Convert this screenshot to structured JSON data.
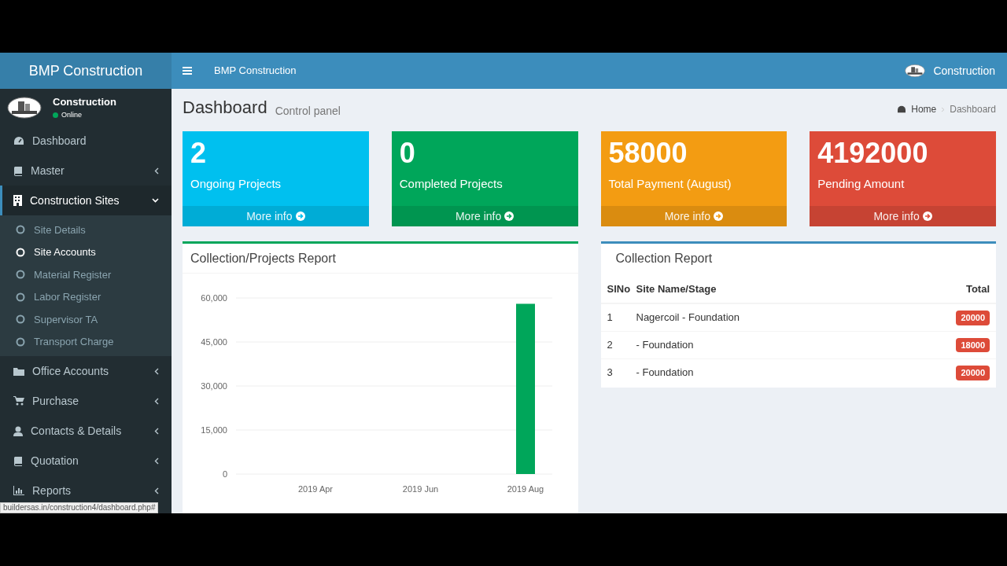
{
  "brand": "BMP Construction",
  "topbar": {
    "title": "BMP Construction",
    "user": "Construction"
  },
  "user_panel": {
    "name": "Construction",
    "status": "Online"
  },
  "menu": [
    {
      "label": "Dashboard",
      "kind": "link"
    },
    {
      "label": "Master",
      "kind": "tree",
      "expanded": false
    },
    {
      "label": "Construction Sites",
      "kind": "tree",
      "expanded": true,
      "children": [
        {
          "label": "Site Details",
          "selected": false
        },
        {
          "label": "Site Accounts",
          "selected": true
        },
        {
          "label": "Material Register",
          "selected": false
        },
        {
          "label": "Labor Register",
          "selected": false
        },
        {
          "label": "Supervisor TA",
          "selected": false
        },
        {
          "label": "Transport Charge",
          "selected": false
        }
      ]
    },
    {
      "label": "Office Accounts",
      "kind": "tree",
      "expanded": false
    },
    {
      "label": "Purchase",
      "kind": "tree",
      "expanded": false
    },
    {
      "label": "Contacts & Details",
      "kind": "tree",
      "expanded": false
    },
    {
      "label": "Quotation",
      "kind": "tree",
      "expanded": false
    },
    {
      "label": "Reports",
      "kind": "tree",
      "expanded": false
    }
  ],
  "page": {
    "title": "Dashboard",
    "subtitle": "Control panel",
    "breadcrumb": [
      "Home",
      "Dashboard"
    ]
  },
  "stats": [
    {
      "value": "2",
      "label": "Ongoing Projects",
      "link": "More info",
      "color": "#00c0ef"
    },
    {
      "value": "0",
      "label": "Completed Projects",
      "link": "More info",
      "color": "#00a65a"
    },
    {
      "value": "58000",
      "label": "Total Payment (August)",
      "link": "More info",
      "color": "#f39c12"
    },
    {
      "value": "4192000",
      "label": "Pending Amount",
      "link": "More info",
      "color": "#dd4b39"
    }
  ],
  "chart_card": {
    "title": "Collection/Projects Report",
    "chart_data": {
      "type": "bar",
      "categories": [
        "2019 Apr",
        "2019 Jun",
        "2019 Aug"
      ],
      "series": [
        {
          "color": "#00a65a",
          "values": [
            null,
            null,
            58000
          ]
        }
      ],
      "grid": true,
      "ylim": [
        0,
        60000
      ],
      "yticks": [
        {
          "value": 0,
          "label": "0"
        },
        {
          "value": 15000,
          "label": "15,000"
        },
        {
          "value": 30000,
          "label": "30,000"
        },
        {
          "value": 45000,
          "label": "45,000"
        },
        {
          "value": 60000,
          "label": "60,000"
        }
      ]
    }
  },
  "report": {
    "title": "Collection Report",
    "columns": [
      "SlNo",
      "Site Name/Stage",
      "Total"
    ],
    "rows": [
      {
        "no": "1",
        "site": "Nagercoil - Foundation",
        "total": "20000"
      },
      {
        "no": "2",
        "site": "- Foundation",
        "total": "18000"
      },
      {
        "no": "3",
        "site": "- Foundation",
        "total": "20000"
      }
    ]
  },
  "status_url": "buildersas.in/construction4/dashboard.php#"
}
